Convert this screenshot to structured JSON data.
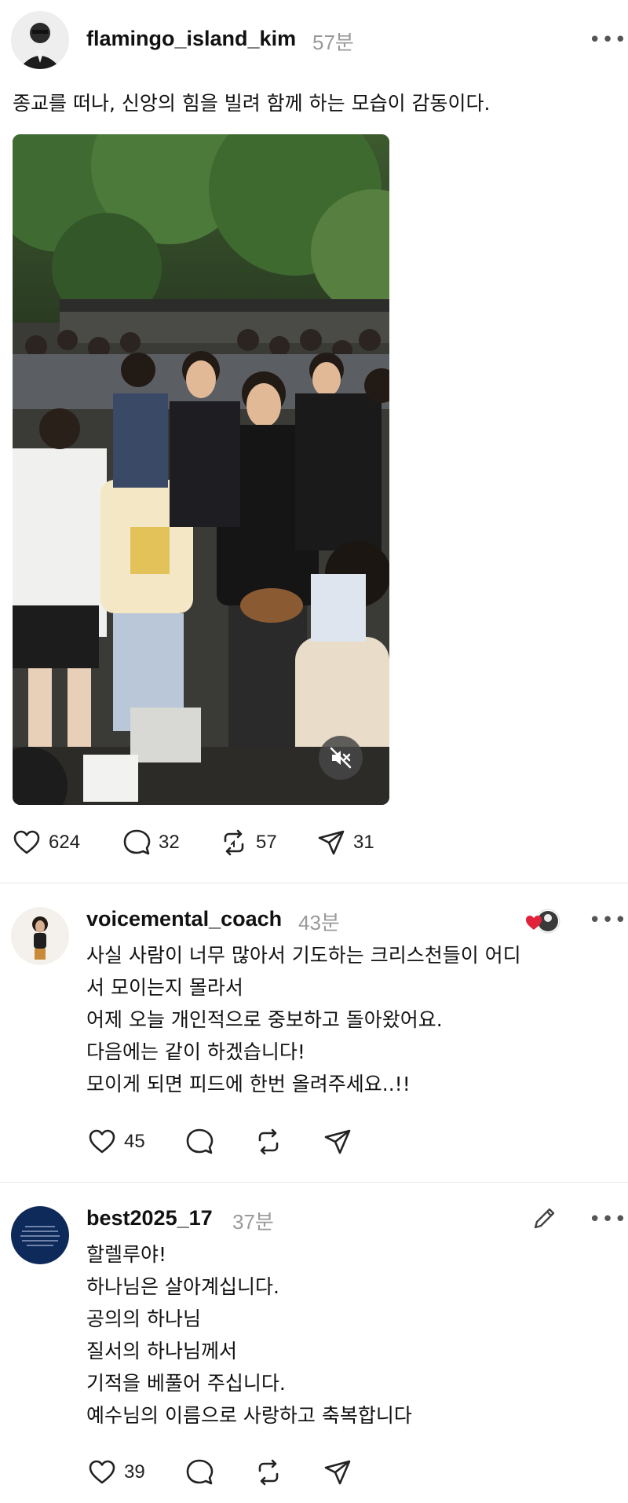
{
  "post": {
    "username": "flamingo_island_kim",
    "time": "57분",
    "text": "종교를 떠나, 신앙의 힘을 빌려 함께 하는 모습이 감동이다.",
    "actions": {
      "likes": "624",
      "comments": "32",
      "reposts": "57",
      "shares": "31"
    }
  },
  "replies": [
    {
      "username": "voicemental_coach",
      "time": "43분",
      "lines": [
        "사실 사람이 너무 많아서 기도하는 크리스천들이 어디",
        "서 모이는지 몰라서",
        "어제 오늘 개인적으로 중보하고 돌아왔어요.",
        "다음에는 같이 하겠습니다!",
        "모이게 되면 피드에 한번 올려주세요..!!"
      ],
      "likes": "45"
    },
    {
      "username": "best2025_17",
      "time": "37분",
      "lines": [
        "할렐루야!",
        "하나님은 살아계십니다.",
        "공의의 하나님",
        "질서의 하나님께서",
        "기적을 베풀어 주십니다.",
        "예수님의 이름으로 사랑하고 축복합니다"
      ],
      "likes": "39"
    }
  ],
  "more_label": "•••",
  "icons": [
    "heart-icon",
    "comment-icon",
    "repost-icon",
    "share-icon",
    "mute-icon",
    "edit-icon",
    "more-icon"
  ],
  "colors": {
    "accent_heart": "#e0223a",
    "muted_text": "#9a9a9a"
  }
}
